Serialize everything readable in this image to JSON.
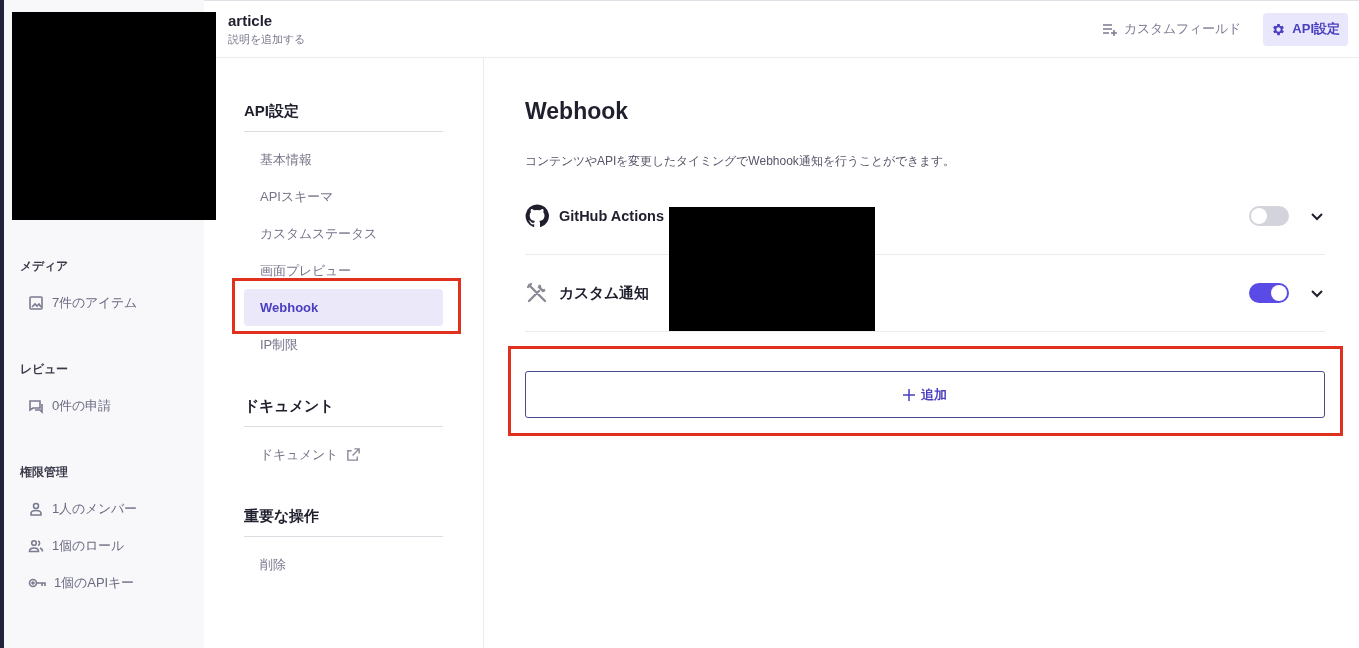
{
  "header": {
    "title": "article",
    "description": "説明を追加する",
    "actions": [
      {
        "label": "カスタムフィールド",
        "selected": false
      },
      {
        "label": "API設定",
        "selected": true
      }
    ]
  },
  "sidebar": {
    "sections": [
      {
        "title": "メディア",
        "items": [
          {
            "label": "7件のアイテム"
          }
        ]
      },
      {
        "title": "レビュー",
        "items": [
          {
            "label": "0件の申請"
          }
        ]
      },
      {
        "title": "権限管理",
        "items": [
          {
            "label": "1人のメンバー"
          },
          {
            "label": "1個のロール"
          },
          {
            "label": "1個のAPIキー"
          }
        ]
      }
    ]
  },
  "settings_nav": {
    "sections": [
      {
        "title": "API設定",
        "items": [
          {
            "label": "基本情報",
            "selected": false,
            "highlighted": false
          },
          {
            "label": "APIスキーマ",
            "selected": false,
            "highlighted": false
          },
          {
            "label": "カスタムステータス",
            "selected": false,
            "highlighted": false
          },
          {
            "label": "画面プレビュー",
            "selected": false,
            "highlighted": false
          },
          {
            "label": "Webhook",
            "selected": true,
            "highlighted": true
          },
          {
            "label": "IP制限",
            "selected": false,
            "highlighted": false
          }
        ]
      },
      {
        "title": "ドキュメント",
        "items": [
          {
            "label": "ドキュメント",
            "selected": false,
            "highlighted": false,
            "external": true
          }
        ]
      },
      {
        "title": "重要な操作",
        "items": [
          {
            "label": "削除",
            "selected": false,
            "highlighted": false
          }
        ]
      }
    ]
  },
  "content": {
    "title": "Webhook",
    "description": "コンテンツやAPIを変更したタイミングでWebhook通知を行うことができます。",
    "webhooks": [
      {
        "kind": "github",
        "name": "GitHub Actions",
        "on": false,
        "expanded": false
      },
      {
        "kind": "custom",
        "name": "カスタム通知",
        "on": true,
        "expanded": false
      }
    ],
    "add_button": {
      "label": "追加",
      "highlighted": true
    }
  }
}
